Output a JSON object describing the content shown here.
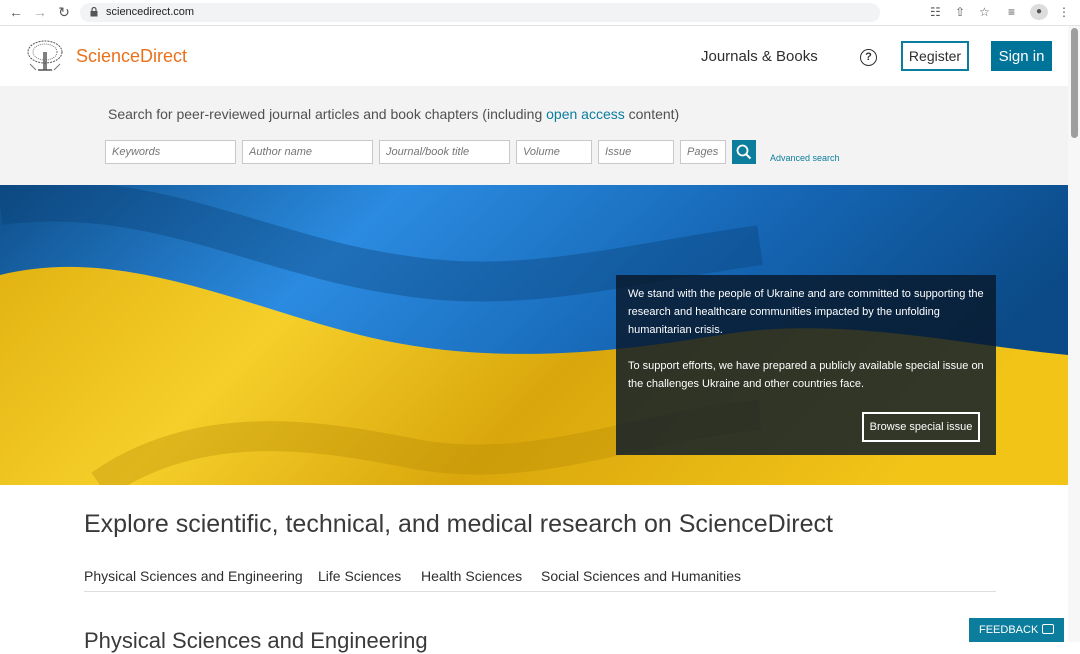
{
  "browser": {
    "url": "sciencedirect.com",
    "icons": [
      "back-icon",
      "forward-icon",
      "reload-icon",
      "lock-icon",
      "translate-icon",
      "share-icon",
      "star-icon",
      "reading-list-icon",
      "profile-icon",
      "more-icon"
    ]
  },
  "header": {
    "brand": "ScienceDirect",
    "journals_books": "Journals & Books",
    "help_symbol": "?",
    "register": "Register",
    "sign_in": "Sign in"
  },
  "search": {
    "prefix": "Search for peer-reviewed journal articles and book chapters (including ",
    "open_access": "open access",
    "suffix": " content)",
    "keywords_placeholder": "Keywords",
    "author_placeholder": "Author name",
    "journal_placeholder": "Journal/book title",
    "volume_placeholder": "Volume",
    "issue_placeholder": "Issue",
    "pages_placeholder": "Pages",
    "advanced": "Advanced search"
  },
  "hero": {
    "paragraph1": "We stand with the people of Ukraine and are committed to supporting the research and healthcare communities impacted by the unfolding humanitarian crisis.",
    "paragraph2": "To support efforts, we have prepared a publicly available special issue on the challenges Ukraine and other countries face.",
    "button": "Browse special issue"
  },
  "explore": {
    "title": "Explore scientific, technical, and medical research on ScienceDirect",
    "tabs": [
      "Physical Sciences and Engineering",
      "Life Sciences",
      "Health Sciences",
      "Social Sciences and Humanities"
    ],
    "section_title": "Physical Sciences and Engineering"
  },
  "feedback": {
    "label": "FEEDBACK"
  },
  "colors": {
    "brand_orange": "#e9711c",
    "accent_teal": "#0c7d9d",
    "flag_blue": "#1b74c5",
    "flag_yellow": "#f2c418"
  }
}
